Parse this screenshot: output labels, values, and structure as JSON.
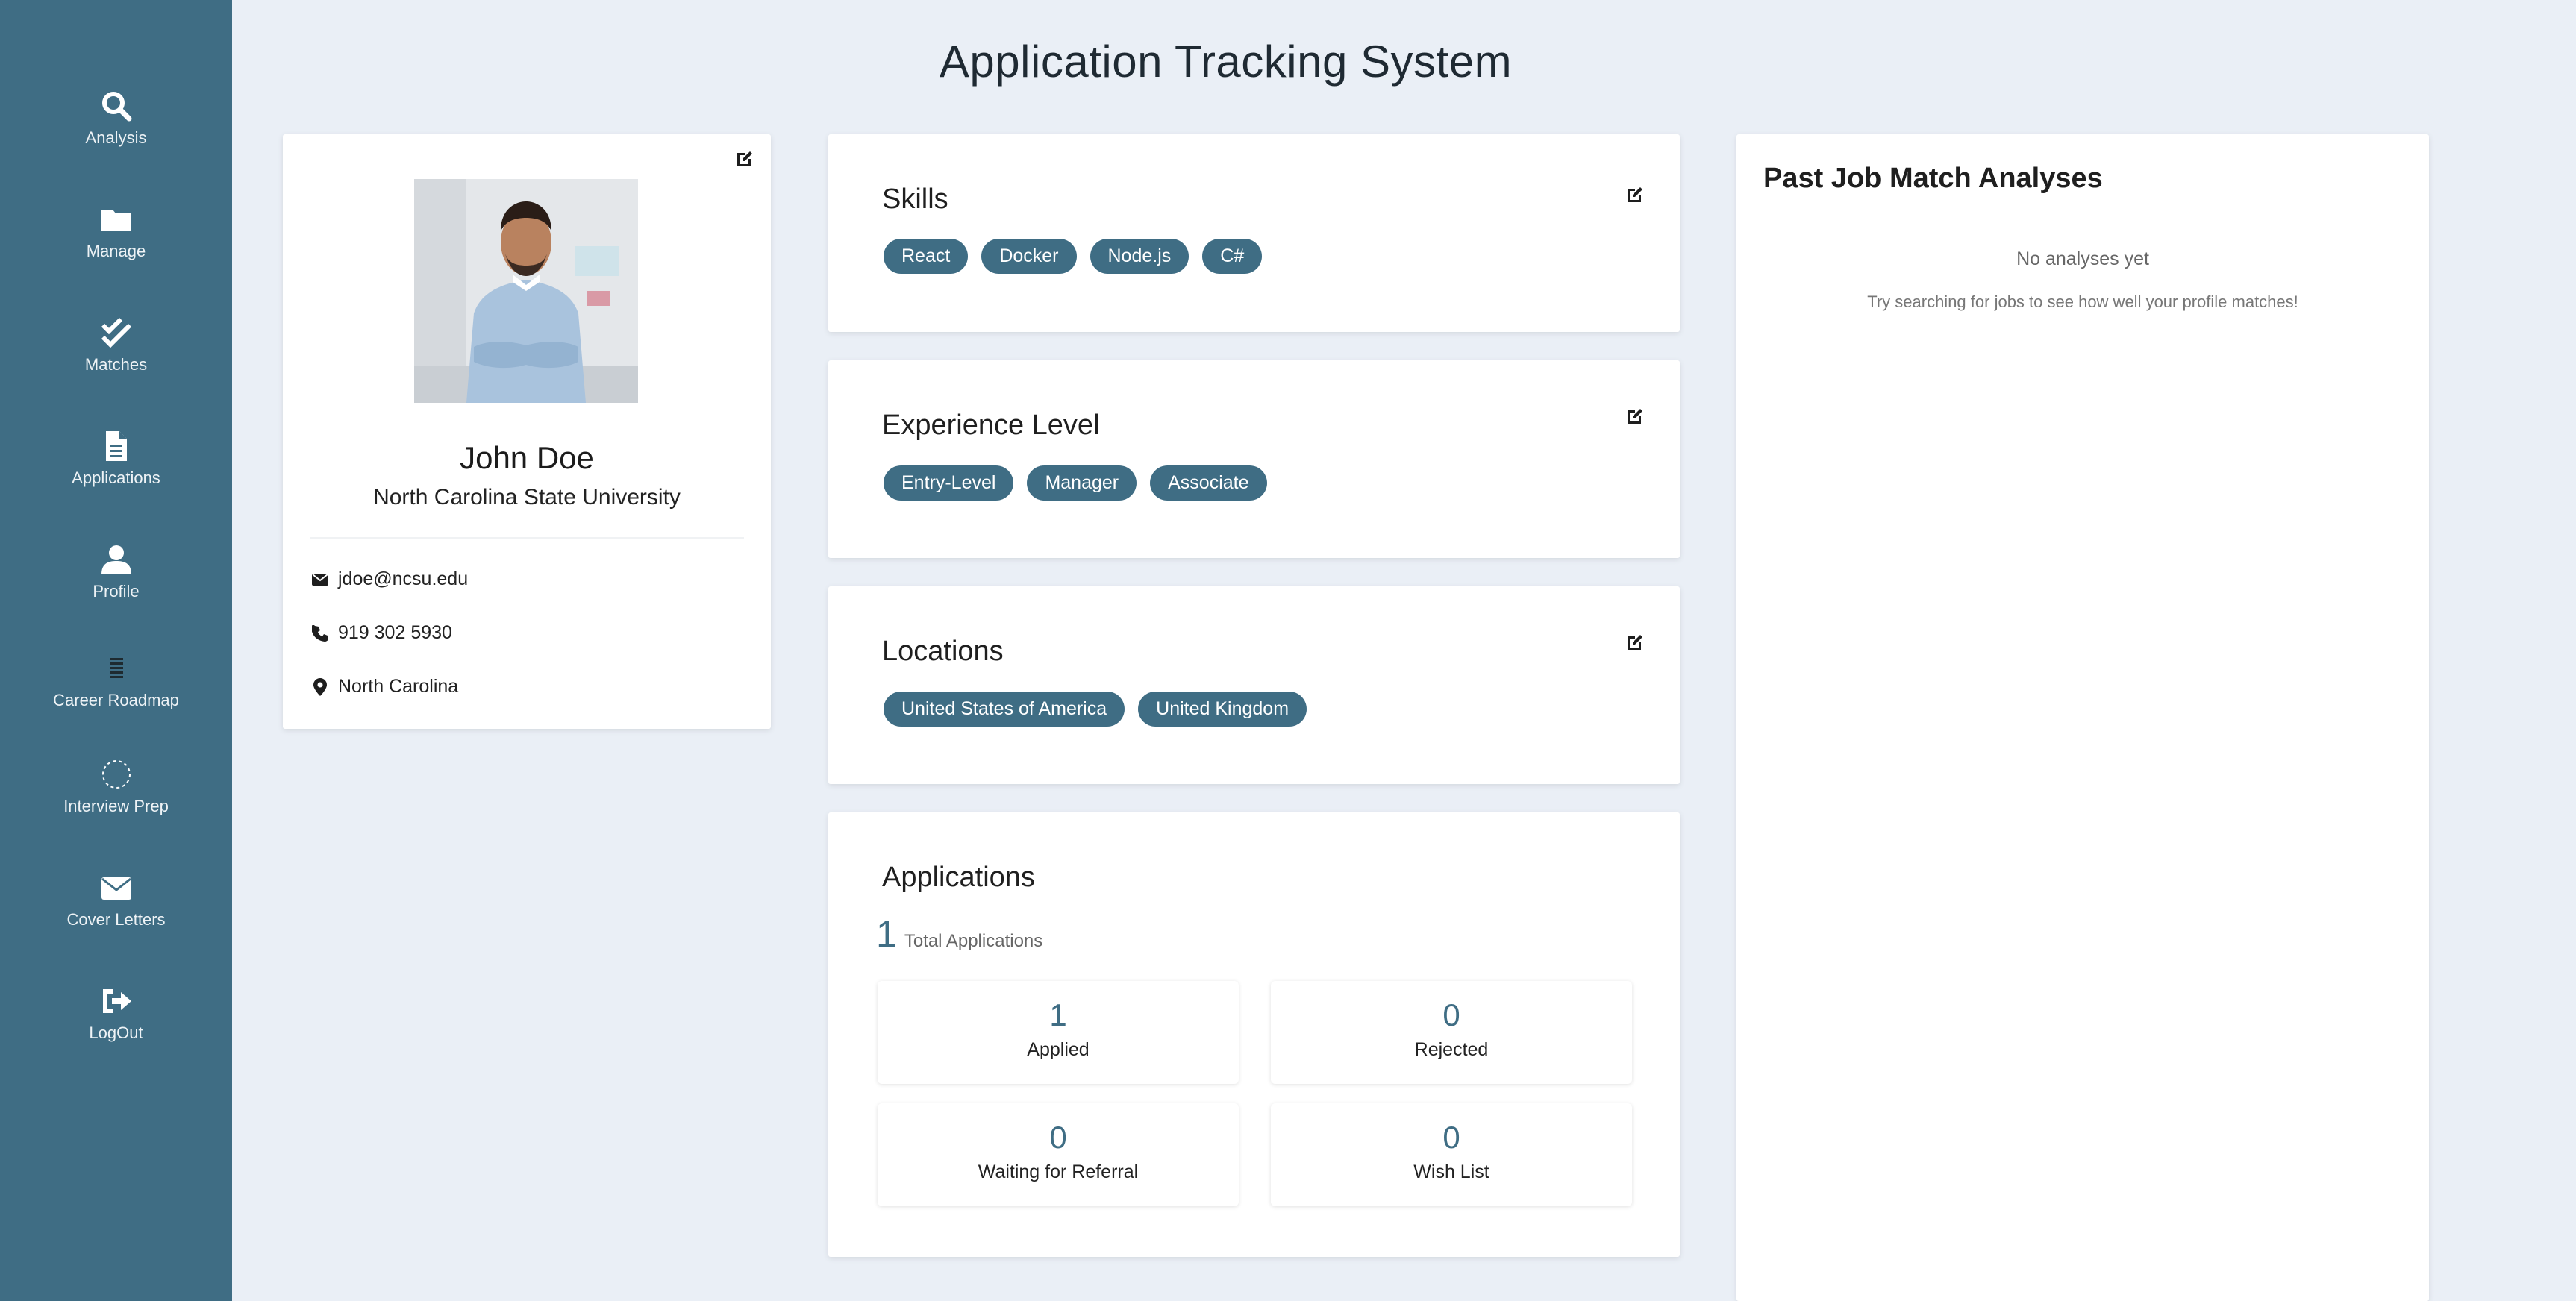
{
  "app": {
    "title": "Application Tracking System"
  },
  "sidebar": {
    "items": [
      {
        "label": "Analysis",
        "icon": "search-icon"
      },
      {
        "label": "Manage",
        "icon": "folder-icon"
      },
      {
        "label": "Matches",
        "icon": "double-check-icon"
      },
      {
        "label": "Applications",
        "icon": "document-icon"
      },
      {
        "label": "Profile",
        "icon": "user-icon"
      },
      {
        "label": "Career Roadmap",
        "icon": "list-icon"
      },
      {
        "label": "Interview Prep",
        "icon": "spinner-icon"
      },
      {
        "label": "Cover Letters",
        "icon": "envelope-icon"
      },
      {
        "label": "LogOut",
        "icon": "logout-icon"
      }
    ]
  },
  "profile": {
    "name": "John Doe",
    "school": "North Carolina State University",
    "email": "jdoe@ncsu.edu",
    "phone": "919 302 5930",
    "location": "North Carolina"
  },
  "skills": {
    "title": "Skills",
    "items": [
      "React",
      "Docker",
      "Node.js",
      "C#"
    ]
  },
  "experience": {
    "title": "Experience Level",
    "items": [
      "Entry-Level",
      "Manager",
      "Associate"
    ]
  },
  "locations": {
    "title": "Locations",
    "items": [
      "United States of America",
      "United Kingdom"
    ]
  },
  "applications": {
    "title": "Applications",
    "total": "1",
    "total_label": "Total Applications",
    "stats": [
      {
        "value": "1",
        "label": "Applied"
      },
      {
        "value": "0",
        "label": "Rejected"
      },
      {
        "value": "0",
        "label": "Waiting for Referral"
      },
      {
        "value": "0",
        "label": "Wish List"
      }
    ]
  },
  "analyses": {
    "title": "Past Job Match Analyses",
    "empty_title": "No analyses yet",
    "empty_subtitle": "Try searching for jobs to see how well your profile matches!"
  },
  "colors": {
    "sidebar": "#3f6d84",
    "accent": "#3f6d84",
    "background": "#eaeff6"
  }
}
